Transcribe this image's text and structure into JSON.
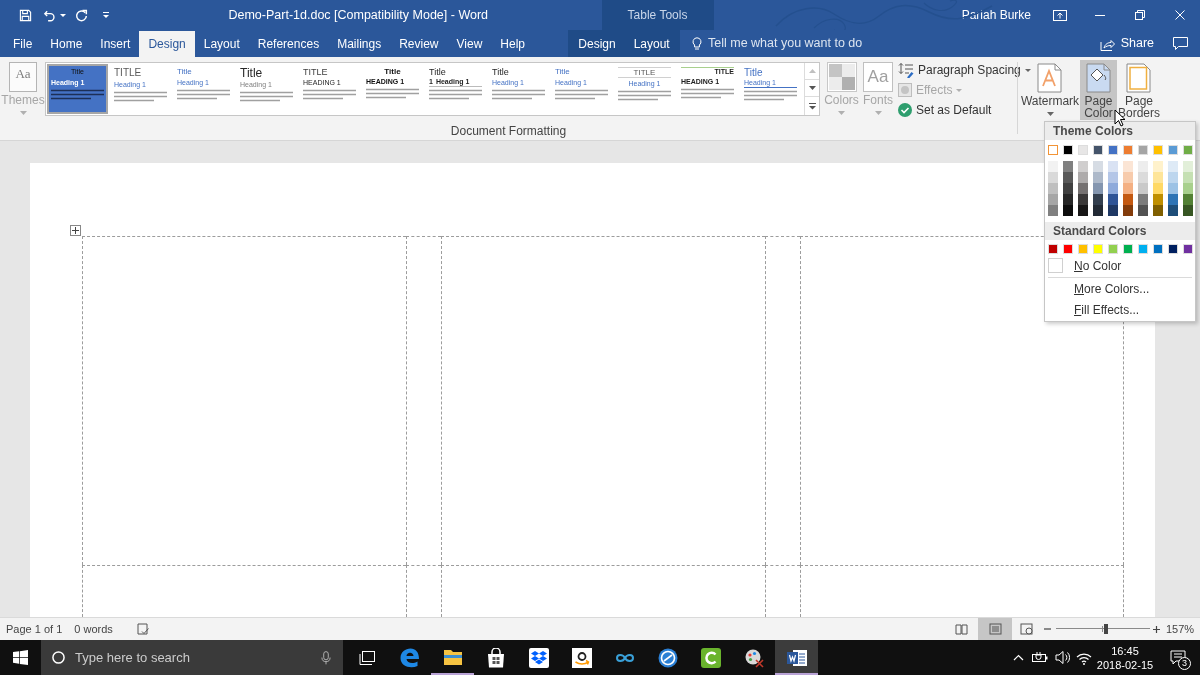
{
  "window": {
    "title": "Demo-Part-1d.doc [Compatibility Mode] - Word",
    "user": "Pariah Burke",
    "contextual_group": "Table Tools"
  },
  "tabs": [
    {
      "label": "File",
      "selected": false
    },
    {
      "label": "Home",
      "selected": false
    },
    {
      "label": "Insert",
      "selected": false
    },
    {
      "label": "Design",
      "selected": true
    },
    {
      "label": "Layout",
      "selected": false
    },
    {
      "label": "References",
      "selected": false
    },
    {
      "label": "Mailings",
      "selected": false
    },
    {
      "label": "Review",
      "selected": false
    },
    {
      "label": "View",
      "selected": false
    },
    {
      "label": "Help",
      "selected": false
    }
  ],
  "contextual_tabs": [
    {
      "label": "Design",
      "selected": false
    },
    {
      "label": "Layout",
      "selected": false
    }
  ],
  "tell_me": {
    "placeholder": "Tell me what you want to do"
  },
  "share": {
    "label": "Share"
  },
  "ribbon": {
    "themes": {
      "label": "Themes",
      "glyph": "Aa",
      "disabled": true
    },
    "style_sets": [
      {
        "kind": "shaded",
        "title": "Title",
        "heading": "Heading 1",
        "selected": true
      },
      {
        "kind": "caps",
        "title": "TITLE",
        "heading": "Heading 1",
        "selected": false
      },
      {
        "kind": "minimal",
        "title": "Title",
        "heading": "Heading 1",
        "selected": false
      },
      {
        "kind": "large",
        "title": "Title",
        "heading": "Heading 1",
        "selected": false
      },
      {
        "kind": "spaced",
        "title": "TITLE",
        "heading": "HEADING 1",
        "selected": false
      },
      {
        "kind": "bold",
        "title": "Title",
        "heading": "HEADING 1",
        "selected": false
      },
      {
        "kind": "numbered",
        "title": "Title",
        "number": "1",
        "heading": "Heading 1",
        "selected": false
      },
      {
        "kind": "basic",
        "title": "Title",
        "heading": "Heading 1",
        "selected": false
      },
      {
        "kind": "lined",
        "title": "Title",
        "heading": "Heading 1",
        "selected": false
      },
      {
        "kind": "centered",
        "title": "TITLE",
        "heading": "Heading 1",
        "selected": false
      },
      {
        "kind": "flush",
        "title": "TITLE",
        "heading": "HEADING 1",
        "selected": false
      },
      {
        "kind": "accent",
        "title": "Title",
        "heading": "Heading 1",
        "selected": false
      }
    ],
    "colors": {
      "label": "Colors",
      "disabled": true
    },
    "fonts": {
      "label": "Fonts",
      "glyph": "Aa",
      "disabled": true
    },
    "commands": [
      {
        "kind": "paragraph-spacing",
        "label": "Paragraph Spacing",
        "disabled": false
      },
      {
        "kind": "effects",
        "label": "Effects",
        "disabled": true
      },
      {
        "kind": "set-default",
        "label": "Set as Default",
        "disabled": false
      }
    ],
    "group_label": "Document Formatting",
    "page_background": [
      {
        "kind": "watermark",
        "label": "Watermark",
        "expanded": false
      },
      {
        "kind": "page-color",
        "label": "Page Color",
        "expanded": true
      },
      {
        "kind": "page-borders",
        "label": "Page Borders",
        "expanded": false
      }
    ]
  },
  "page_color_menu": {
    "theme_heading": "Theme Colors",
    "theme_colors": [
      {
        "color": "#ffffff",
        "selected": true,
        "shades": [
          {
            "color": "#f2f2f2",
            "selected": false
          },
          {
            "color": "#d9d9d9",
            "selected": false
          },
          {
            "color": "#bfbfbf",
            "selected": false
          },
          {
            "color": "#a6a6a6",
            "selected": false
          },
          {
            "color": "#808080",
            "selected": false
          }
        ]
      },
      {
        "color": "#000000",
        "selected": false,
        "shades": [
          {
            "color": "#808080",
            "selected": false
          },
          {
            "color": "#595959",
            "selected": false
          },
          {
            "color": "#404040",
            "selected": false
          },
          {
            "color": "#262626",
            "selected": false
          },
          {
            "color": "#0d0d0d",
            "selected": false
          }
        ]
      },
      {
        "color": "#e7e6e6",
        "selected": false,
        "shades": [
          {
            "color": "#d0cece",
            "selected": false
          },
          {
            "color": "#aeabab",
            "selected": false
          },
          {
            "color": "#757171",
            "selected": false
          },
          {
            "color": "#3a3838",
            "selected": false
          },
          {
            "color": "#171616",
            "selected": false
          }
        ]
      },
      {
        "color": "#44546a",
        "selected": false,
        "shades": [
          {
            "color": "#d6dce4",
            "selected": false
          },
          {
            "color": "#adb9ca",
            "selected": false
          },
          {
            "color": "#8496b0",
            "selected": false
          },
          {
            "color": "#333f4f",
            "selected": false
          },
          {
            "color": "#222a35",
            "selected": false
          }
        ]
      },
      {
        "color": "#4472c4",
        "selected": false,
        "shades": [
          {
            "color": "#d9e2f3",
            "selected": false
          },
          {
            "color": "#b4c6e7",
            "selected": false
          },
          {
            "color": "#8eaadb",
            "selected": false
          },
          {
            "color": "#2f5496",
            "selected": false
          },
          {
            "color": "#1f3864",
            "selected": false
          }
        ]
      },
      {
        "color": "#ed7d31",
        "selected": false,
        "shades": [
          {
            "color": "#fbe5d5",
            "selected": false
          },
          {
            "color": "#f7cbac",
            "selected": false
          },
          {
            "color": "#f4b083",
            "selected": false
          },
          {
            "color": "#c45911",
            "selected": false
          },
          {
            "color": "#833c0b",
            "selected": false
          }
        ]
      },
      {
        "color": "#a5a5a5",
        "selected": false,
        "shades": [
          {
            "color": "#ededed",
            "selected": false
          },
          {
            "color": "#dbdbdb",
            "selected": false
          },
          {
            "color": "#c9c9c9",
            "selected": false
          },
          {
            "color": "#7b7b7b",
            "selected": false
          },
          {
            "color": "#525252",
            "selected": false
          }
        ]
      },
      {
        "color": "#ffc000",
        "selected": false,
        "shades": [
          {
            "color": "#fff2cc",
            "selected": false
          },
          {
            "color": "#fee599",
            "selected": false
          },
          {
            "color": "#ffd965",
            "selected": false
          },
          {
            "color": "#bf8f00",
            "selected": false
          },
          {
            "color": "#7f5f00",
            "selected": false
          }
        ]
      },
      {
        "color": "#5b9bd5",
        "selected": false,
        "shades": [
          {
            "color": "#deeaf6",
            "selected": false
          },
          {
            "color": "#bdd6ee",
            "selected": false
          },
          {
            "color": "#9cc2e5",
            "selected": false
          },
          {
            "color": "#2e74b5",
            "selected": false
          },
          {
            "color": "#1e4e79",
            "selected": false
          }
        ]
      },
      {
        "color": "#70ad47",
        "selected": false,
        "shades": [
          {
            "color": "#e2efd9",
            "selected": false
          },
          {
            "color": "#c5e0b3",
            "selected": false
          },
          {
            "color": "#a8d08d",
            "selected": false
          },
          {
            "color": "#538135",
            "selected": false
          },
          {
            "color": "#375623",
            "selected": false
          }
        ]
      }
    ],
    "standard_heading": "Standard Colors",
    "standard_colors": [
      {
        "color": "#c00000",
        "selected": false
      },
      {
        "color": "#ff0000",
        "selected": false
      },
      {
        "color": "#ffc000",
        "selected": false
      },
      {
        "color": "#ffff00",
        "selected": false
      },
      {
        "color": "#92d050",
        "selected": false
      },
      {
        "color": "#00b050",
        "selected": false
      },
      {
        "color": "#00b0f0",
        "selected": false
      },
      {
        "color": "#0070c0",
        "selected": false
      },
      {
        "color": "#002060",
        "selected": false
      },
      {
        "color": "#7030a0",
        "selected": false
      }
    ],
    "no_color": {
      "label": "No Color"
    },
    "items": [
      {
        "label": "More Colors..."
      },
      {
        "label": "Fill Effects..."
      }
    ]
  },
  "document": {
    "table": {
      "columns": [
        {
          "kind": "wide"
        },
        {
          "kind": "narrow"
        },
        {
          "kind": "wide"
        },
        {
          "kind": "narrow"
        },
        {
          "kind": "wide"
        }
      ],
      "rows": [
        {
          "kind": "full"
        },
        {
          "kind": "cut"
        }
      ]
    }
  },
  "status_bar": {
    "page": "Page 1 of 1",
    "words": "0 words",
    "views": [
      {
        "kind": "read",
        "selected": false
      },
      {
        "kind": "print",
        "selected": true
      },
      {
        "kind": "web",
        "selected": false
      }
    ],
    "zoom": {
      "level": 0.53,
      "reading": "157%"
    }
  },
  "taskbar": {
    "search": {
      "placeholder": "Type here to search"
    },
    "apps": [
      {
        "kind": "task-view",
        "running": false,
        "active": false
      },
      {
        "kind": "browser",
        "running": false,
        "active": false
      },
      {
        "kind": "folder",
        "running": true,
        "active": false
      },
      {
        "kind": "bag",
        "running": false,
        "active": false
      },
      {
        "kind": "box",
        "running": false,
        "active": false
      },
      {
        "kind": "smile",
        "running": false,
        "active": false
      },
      {
        "kind": "infinity",
        "running": false,
        "active": false
      },
      {
        "kind": "circle",
        "running": false,
        "active": false
      },
      {
        "kind": "arc-tile",
        "running": false,
        "active": false
      },
      {
        "kind": "scissors",
        "running": false,
        "active": false
      },
      {
        "kind": "document",
        "running": true,
        "active": true
      }
    ],
    "clock": {
      "time": "16:45",
      "date": "2018-02-15"
    },
    "notifications": {
      "count": "3"
    }
  }
}
